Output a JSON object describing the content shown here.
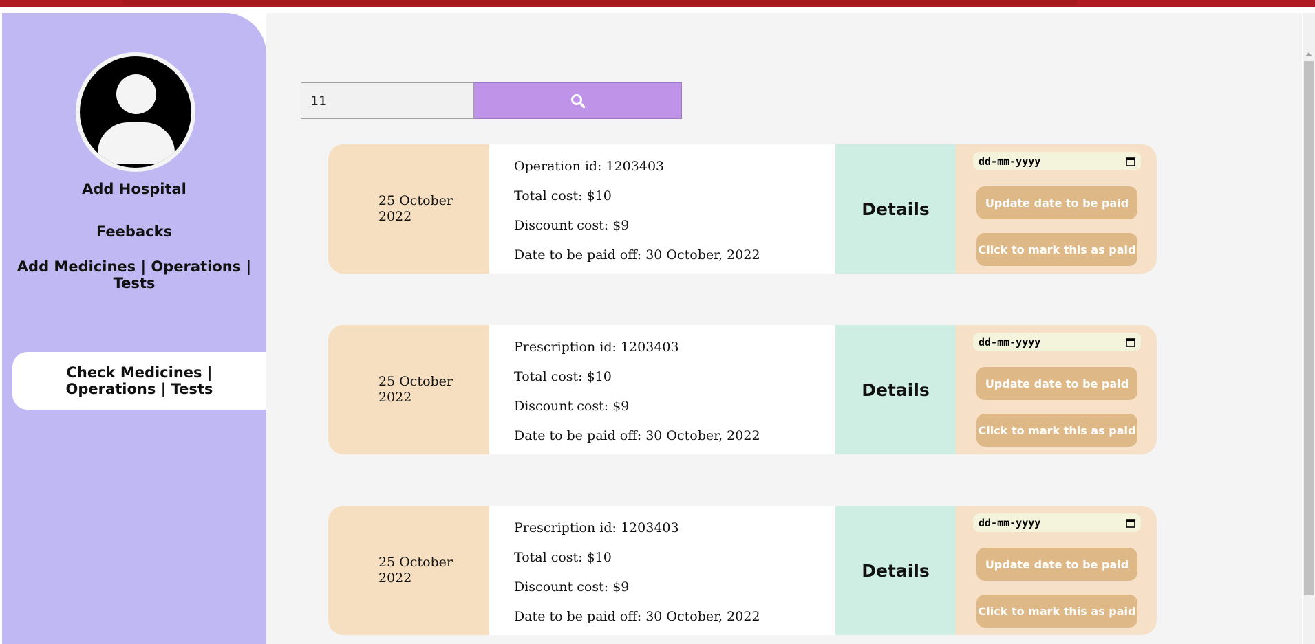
{
  "search": {
    "value": "11"
  },
  "sidebar": {
    "items": [
      {
        "label": "Add Hospital"
      },
      {
        "label": "Feebacks"
      },
      {
        "label": "Add Medicines | Operations | Tests"
      },
      {
        "label": "Check Medicines | Operations | Tests"
      }
    ]
  },
  "cards": [
    {
      "date": "25 October 2022",
      "id_line": "Operation id: 1203403",
      "total": "Total cost: $10",
      "discount": "Discount cost: $9",
      "due": "Date to be paid off: 30 October, 2022",
      "details": "Details",
      "date_placeholder": "dd-mm-yyyy",
      "update_label": "Update date to be paid",
      "mark_label": "Click to mark this as paid"
    },
    {
      "date": "25 October 2022",
      "id_line": "Prescription id: 1203403",
      "total": "Total cost: $10",
      "discount": "Discount cost: $9",
      "due": "Date to be paid off: 30 October, 2022",
      "details": "Details",
      "date_placeholder": "dd-mm-yyyy",
      "update_label": "Update date to be paid",
      "mark_label": "Click to mark this as paid"
    },
    {
      "date": "25 October 2022",
      "id_line": "Prescription id: 1203403",
      "total": "Total cost: $10",
      "discount": "Discount cost: $9",
      "due": "Date to be paid off: 30 October, 2022",
      "details": "Details",
      "date_placeholder": "dd-mm-yyyy",
      "update_label": "Update date to be paid",
      "mark_label": "Click to mark this as paid"
    }
  ],
  "colors": {
    "sidebar": "#c0b8f2",
    "search_button": "#bf93e8",
    "date_panel": "#f6dfc1",
    "details_panel": "#cfeee3",
    "action_button": "#deb887"
  },
  "icons": {
    "search": "search-icon",
    "avatar": "user-avatar-icon",
    "calendar": "calendar-icon"
  }
}
